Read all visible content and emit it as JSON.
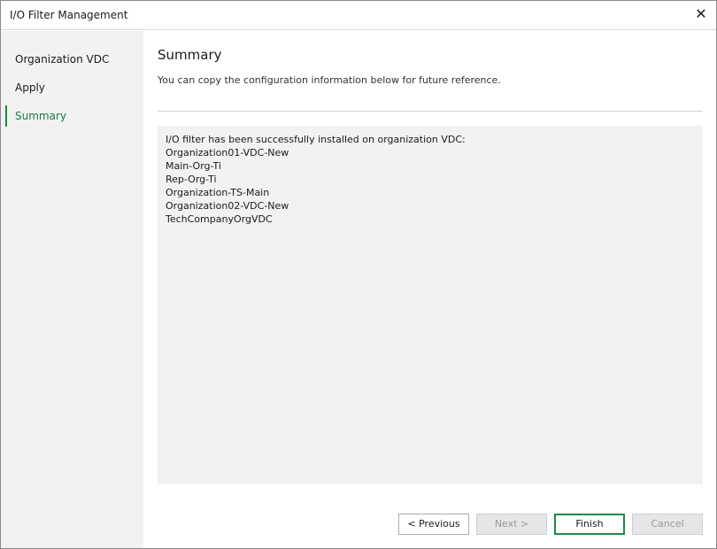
{
  "window": {
    "title": "I/O Filter Management"
  },
  "sidebar": {
    "steps": [
      {
        "label": "Organization VDC",
        "active": false
      },
      {
        "label": "Apply",
        "active": false
      },
      {
        "label": "Summary",
        "active": true
      }
    ]
  },
  "main": {
    "heading": "Summary",
    "subtitle": "You can copy the configuration information below for future reference.",
    "summary_lines": [
      "I/O filter has been successfully installed on organization VDC:",
      "Organization01-VDC-New",
      "Main-Org-Ti",
      "Rep-Org-Ti",
      "Organization-TS-Main",
      "Organization02-VDC-New",
      "TechCompanyOrgVDC"
    ]
  },
  "buttons": {
    "previous": "< Previous",
    "next": "Next >",
    "finish": "Finish",
    "cancel": "Cancel"
  },
  "colors": {
    "accent": "#1c8a43"
  },
  "icons": {
    "close": "close-icon"
  }
}
